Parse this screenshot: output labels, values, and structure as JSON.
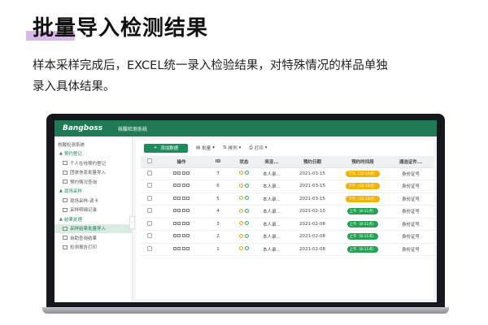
{
  "hero": {
    "title": "批量导入检测结果",
    "desc_line1": "样本采样完成后，EXCEL统一录入检验结果，对特殊情况的样品单独",
    "desc_line2": "录入具体结果。"
  },
  "app": {
    "logo": "Bangboss",
    "system_name": "核酸检测系统"
  },
  "sidebar": {
    "root": "核酸检测系统",
    "groups": [
      {
        "label": "预约登记",
        "items": [
          "个人在线预约登记",
          "团体信息批量导入",
          "预约情况查询"
        ]
      },
      {
        "label": "现场采样",
        "items": [
          "现场采样-读卡",
          "采样明细记录"
        ]
      },
      {
        "label": "结果处理",
        "items": [
          "采样结果批量导入",
          "自助查询结果",
          "检测报告打印"
        ]
      }
    ],
    "active_item": "采样结果批量导入",
    "collapse_glyph": "‹"
  },
  "toolbar": {
    "add_label": "添加数据",
    "add_icon": "+",
    "batch_label": "批量",
    "sort_label": "排列",
    "print_label": "打印",
    "caret": "▾"
  },
  "table": {
    "headers": [
      "",
      "操作",
      "ID",
      "状态",
      "来没...",
      "预约日期",
      "预约时间段",
      "通选证件..."
    ],
    "rows": [
      {
        "id": "7",
        "name": "本人录...",
        "date": "2021-03-15",
        "slot": "下午（12-18点）",
        "slot_color": "y",
        "doc": "身份证号"
      },
      {
        "id": "6",
        "name": "本人录...",
        "date": "2021-03-15",
        "slot": "下午（12-18点）",
        "slot_color": "y",
        "doc": "身份证号"
      },
      {
        "id": "5",
        "name": "本人录...",
        "date": "2021-03-15",
        "slot": "下午（12-18点）",
        "slot_color": "y",
        "doc": "身份证号"
      },
      {
        "id": "4",
        "name": "本人录...",
        "date": "2021-02-10",
        "slot": "上午（8-11点）",
        "slot_color": "g",
        "doc": "身份证号"
      },
      {
        "id": "3",
        "name": "本人录...",
        "date": "2021-02-08",
        "slot": "上午（8-11点）",
        "slot_color": "g",
        "doc": "身份证号"
      },
      {
        "id": "2",
        "name": "本人录...",
        "date": "2021-02-08",
        "slot": "上午（8-11点）",
        "slot_color": "g",
        "doc": "身份证号"
      },
      {
        "id": "1",
        "name": "本人录...",
        "date": "2021-02-08",
        "slot": "上午（8-11点）",
        "slot_color": "g",
        "doc": "身份证号"
      }
    ]
  },
  "colors": {
    "brand_green": "#1f7a55",
    "accent_purple": "#d9b8e8",
    "badge_yellow": "#f0b400",
    "badge_green": "#22a352"
  }
}
